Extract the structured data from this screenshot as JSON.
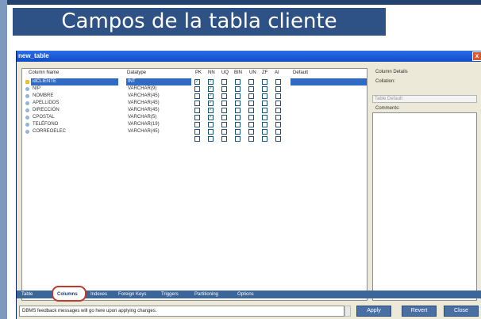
{
  "slide": {
    "title": "Campos de la tabla cliente"
  },
  "window": {
    "title": "new_table",
    "close_glyph": "x"
  },
  "grid": {
    "headers": {
      "column_name": "Column Name",
      "datatype": "Datatype",
      "pk": "PK",
      "nn": "NN",
      "uq": "UQ",
      "bin": "BIN",
      "un": "UN",
      "zf": "ZF",
      "ai": "AI",
      "default": "Default"
    },
    "rows": [
      {
        "name": "idCLIENTE",
        "type": "INT",
        "icon": "key-icon",
        "pk": true,
        "nn": true,
        "selected": true
      },
      {
        "name": "NIP",
        "type": "VARCHAR(9)",
        "icon": "column-icon",
        "pk": false,
        "nn": true,
        "selected": false
      },
      {
        "name": "NOMBRE",
        "type": "VARCHAR(45)",
        "icon": "column-icon",
        "pk": false,
        "nn": true,
        "selected": false
      },
      {
        "name": "APELLIDOS",
        "type": "VARCHAR(45)",
        "icon": "column-icon",
        "pk": false,
        "nn": true,
        "selected": false
      },
      {
        "name": "DIRECCIÓN",
        "type": "VARCHAR(45)",
        "icon": "column-icon",
        "pk": false,
        "nn": true,
        "selected": false
      },
      {
        "name": "CPOSTAL",
        "type": "VARCHAR(5)",
        "icon": "column-icon",
        "pk": false,
        "nn": true,
        "selected": false
      },
      {
        "name": "TELÉFONO",
        "type": "VARCHAR(19)",
        "icon": "column-icon",
        "pk": false,
        "nn": false,
        "selected": false
      },
      {
        "name": "CORREOELEC",
        "type": "VARCHAR(45)",
        "icon": "column-icon",
        "pk": false,
        "nn": false,
        "selected": false
      },
      {
        "name": "",
        "type": "",
        "icon": "",
        "pk": false,
        "nn": false,
        "selected": false
      }
    ],
    "check_mark": "✓"
  },
  "details": {
    "heading": "Column Details",
    "collation_label": "Collation:",
    "collation_value": "Table Default",
    "comments_label": "Comments:"
  },
  "tabs": {
    "items": [
      "Table",
      "Columns",
      "Indexes",
      "Foreign Keys",
      "Triggers",
      "Partitioning",
      "Options"
    ],
    "active": "Columns"
  },
  "footer": {
    "message": "DBMS feedback messages will go here upon applying changes.",
    "apply": "Apply",
    "revert": "Revert",
    "close": "Close"
  },
  "colors": {
    "slide_title_bg": "#2f5286",
    "selection": "#316ac5",
    "tab_strip": "#3c6699",
    "highlight_ring": "#c0392b"
  }
}
